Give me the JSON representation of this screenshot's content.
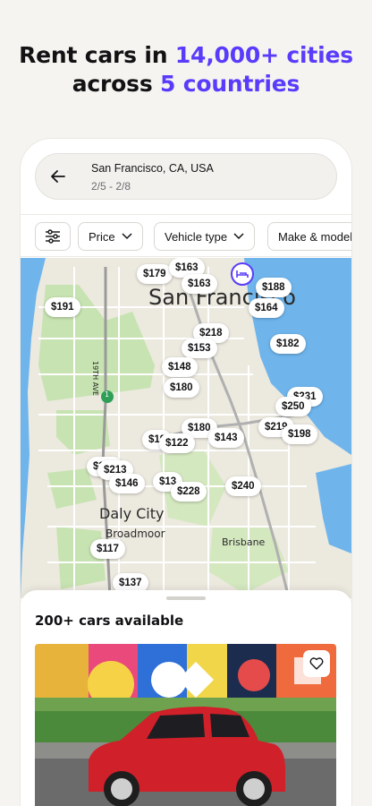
{
  "headline": {
    "part1": "Rent cars in ",
    "highlight1": "14,000+ cities",
    "part2": "across ",
    "highlight2": "5 countries"
  },
  "search": {
    "location": "San Francisco, CA, USA",
    "dates": "2/5 - 2/8"
  },
  "filters": {
    "price": "Price",
    "vehicle_type": "Vehicle type",
    "make_model": "Make & model"
  },
  "map": {
    "city_label": "San Francisco",
    "daly_city": "Daly City",
    "broadmoor": "Broadmoor",
    "brisbane": "Brisbane",
    "street": "19TH AVE",
    "highway": "1",
    "prices": [
      "$179",
      "$163",
      "$163",
      "$188",
      "$191",
      "$164",
      "$218",
      "$153",
      "$182",
      "$148",
      "$180",
      "$231",
      "$250",
      "$180",
      "$219",
      "$19",
      "$122",
      "$143",
      "$198",
      "$219",
      "$213",
      "$146",
      "$13",
      "$228",
      "$240",
      "$117",
      "$137"
    ]
  },
  "results": {
    "count_label": "200+ cars available"
  },
  "colors": {
    "accent": "#593cfb",
    "car": "#d0202a"
  }
}
